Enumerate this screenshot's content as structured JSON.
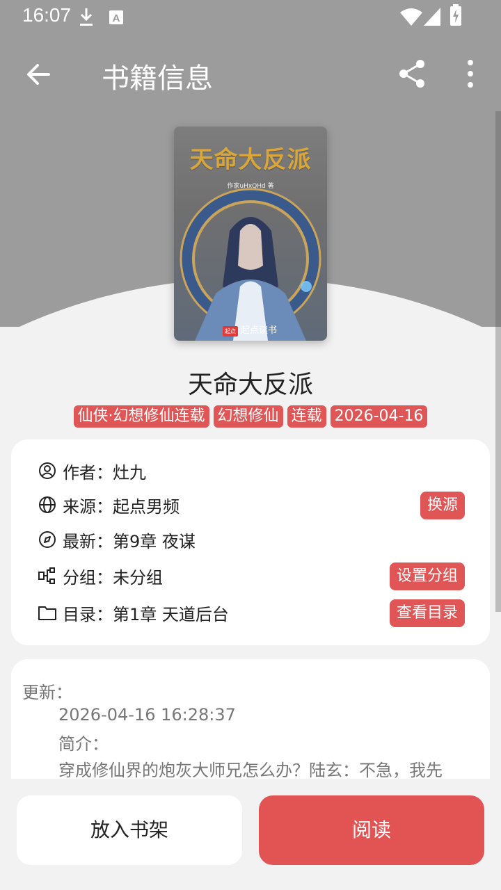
{
  "status_bar": {
    "time": "16:07"
  },
  "app_bar": {
    "title": "书籍信息"
  },
  "cover": {
    "title": "天命大反派",
    "author_line": "作家uHxQHd 著",
    "brand_badge": "起点",
    "brand": "起点读书"
  },
  "book": {
    "title": "天命大反派",
    "tags": [
      "仙侠·幻想修仙连载",
      "幻想修仙",
      "连载",
      "2026-04-16"
    ]
  },
  "info": {
    "author_label": "作者：",
    "author": "灶九",
    "source_label": "来源：",
    "source": "起点男频",
    "change_source": "换源",
    "latest_label": "最新：",
    "latest": "第9章 夜谋",
    "group_label": "分组：",
    "group": "未分组",
    "set_group": "设置分组",
    "toc_label": "目录：",
    "toc": "第1章 天道后台",
    "view_toc": "查看目录"
  },
  "intro": {
    "update_label": "更新：",
    "update_time": "2026-04-16 16:28:37",
    "summary_label": "简介：",
    "summary": "穿成修仙界的炮灰大师兄怎么办？陆玄：不急，我先"
  },
  "actions": {
    "add_shelf": "放入书架",
    "read": "阅读"
  },
  "colors": {
    "accent": "#e25454",
    "header_bg": "#9c9c9c",
    "page_bg": "#f2f2f2"
  }
}
